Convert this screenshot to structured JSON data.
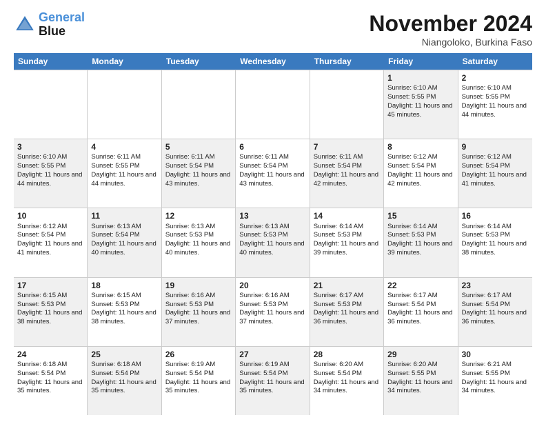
{
  "logo": {
    "line1": "General",
    "line2": "Blue"
  },
  "title": "November 2024",
  "subtitle": "Niangoloko, Burkina Faso",
  "weekdays": [
    "Sunday",
    "Monday",
    "Tuesday",
    "Wednesday",
    "Thursday",
    "Friday",
    "Saturday"
  ],
  "rows": [
    [
      {
        "day": "",
        "content": "",
        "shaded": false
      },
      {
        "day": "",
        "content": "",
        "shaded": false
      },
      {
        "day": "",
        "content": "",
        "shaded": false
      },
      {
        "day": "",
        "content": "",
        "shaded": false
      },
      {
        "day": "",
        "content": "",
        "shaded": false
      },
      {
        "day": "1",
        "content": "Sunrise: 6:10 AM\nSunset: 5:55 PM\nDaylight: 11 hours and 45 minutes.",
        "shaded": true
      },
      {
        "day": "2",
        "content": "Sunrise: 6:10 AM\nSunset: 5:55 PM\nDaylight: 11 hours and 44 minutes.",
        "shaded": false
      }
    ],
    [
      {
        "day": "3",
        "content": "Sunrise: 6:10 AM\nSunset: 5:55 PM\nDaylight: 11 hours and 44 minutes.",
        "shaded": true
      },
      {
        "day": "4",
        "content": "Sunrise: 6:11 AM\nSunset: 5:55 PM\nDaylight: 11 hours and 44 minutes.",
        "shaded": false
      },
      {
        "day": "5",
        "content": "Sunrise: 6:11 AM\nSunset: 5:54 PM\nDaylight: 11 hours and 43 minutes.",
        "shaded": true
      },
      {
        "day": "6",
        "content": "Sunrise: 6:11 AM\nSunset: 5:54 PM\nDaylight: 11 hours and 43 minutes.",
        "shaded": false
      },
      {
        "day": "7",
        "content": "Sunrise: 6:11 AM\nSunset: 5:54 PM\nDaylight: 11 hours and 42 minutes.",
        "shaded": true
      },
      {
        "day": "8",
        "content": "Sunrise: 6:12 AM\nSunset: 5:54 PM\nDaylight: 11 hours and 42 minutes.",
        "shaded": false
      },
      {
        "day": "9",
        "content": "Sunrise: 6:12 AM\nSunset: 5:54 PM\nDaylight: 11 hours and 41 minutes.",
        "shaded": true
      }
    ],
    [
      {
        "day": "10",
        "content": "Sunrise: 6:12 AM\nSunset: 5:54 PM\nDaylight: 11 hours and 41 minutes.",
        "shaded": false
      },
      {
        "day": "11",
        "content": "Sunrise: 6:13 AM\nSunset: 5:54 PM\nDaylight: 11 hours and 40 minutes.",
        "shaded": true
      },
      {
        "day": "12",
        "content": "Sunrise: 6:13 AM\nSunset: 5:53 PM\nDaylight: 11 hours and 40 minutes.",
        "shaded": false
      },
      {
        "day": "13",
        "content": "Sunrise: 6:13 AM\nSunset: 5:53 PM\nDaylight: 11 hours and 40 minutes.",
        "shaded": true
      },
      {
        "day": "14",
        "content": "Sunrise: 6:14 AM\nSunset: 5:53 PM\nDaylight: 11 hours and 39 minutes.",
        "shaded": false
      },
      {
        "day": "15",
        "content": "Sunrise: 6:14 AM\nSunset: 5:53 PM\nDaylight: 11 hours and 39 minutes.",
        "shaded": true
      },
      {
        "day": "16",
        "content": "Sunrise: 6:14 AM\nSunset: 5:53 PM\nDaylight: 11 hours and 38 minutes.",
        "shaded": false
      }
    ],
    [
      {
        "day": "17",
        "content": "Sunrise: 6:15 AM\nSunset: 5:53 PM\nDaylight: 11 hours and 38 minutes.",
        "shaded": true
      },
      {
        "day": "18",
        "content": "Sunrise: 6:15 AM\nSunset: 5:53 PM\nDaylight: 11 hours and 38 minutes.",
        "shaded": false
      },
      {
        "day": "19",
        "content": "Sunrise: 6:16 AM\nSunset: 5:53 PM\nDaylight: 11 hours and 37 minutes.",
        "shaded": true
      },
      {
        "day": "20",
        "content": "Sunrise: 6:16 AM\nSunset: 5:53 PM\nDaylight: 11 hours and 37 minutes.",
        "shaded": false
      },
      {
        "day": "21",
        "content": "Sunrise: 6:17 AM\nSunset: 5:53 PM\nDaylight: 11 hours and 36 minutes.",
        "shaded": true
      },
      {
        "day": "22",
        "content": "Sunrise: 6:17 AM\nSunset: 5:54 PM\nDaylight: 11 hours and 36 minutes.",
        "shaded": false
      },
      {
        "day": "23",
        "content": "Sunrise: 6:17 AM\nSunset: 5:54 PM\nDaylight: 11 hours and 36 minutes.",
        "shaded": true
      }
    ],
    [
      {
        "day": "24",
        "content": "Sunrise: 6:18 AM\nSunset: 5:54 PM\nDaylight: 11 hours and 35 minutes.",
        "shaded": false
      },
      {
        "day": "25",
        "content": "Sunrise: 6:18 AM\nSunset: 5:54 PM\nDaylight: 11 hours and 35 minutes.",
        "shaded": true
      },
      {
        "day": "26",
        "content": "Sunrise: 6:19 AM\nSunset: 5:54 PM\nDaylight: 11 hours and 35 minutes.",
        "shaded": false
      },
      {
        "day": "27",
        "content": "Sunrise: 6:19 AM\nSunset: 5:54 PM\nDaylight: 11 hours and 35 minutes.",
        "shaded": true
      },
      {
        "day": "28",
        "content": "Sunrise: 6:20 AM\nSunset: 5:54 PM\nDaylight: 11 hours and 34 minutes.",
        "shaded": false
      },
      {
        "day": "29",
        "content": "Sunrise: 6:20 AM\nSunset: 5:55 PM\nDaylight: 11 hours and 34 minutes.",
        "shaded": true
      },
      {
        "day": "30",
        "content": "Sunrise: 6:21 AM\nSunset: 5:55 PM\nDaylight: 11 hours and 34 minutes.",
        "shaded": false
      }
    ]
  ]
}
